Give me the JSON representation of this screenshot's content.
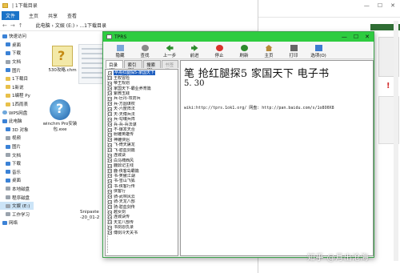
{
  "explorer": {
    "title": "| 1下载目录",
    "ribbon_tabs": [
      "文件",
      "主页",
      "共享",
      "查看"
    ],
    "address": "此电脑 › 文娱 (E:) › ...1下载目录",
    "sidebar": [
      {
        "label": "快速访问",
        "icon": "star-icon",
        "level": 0,
        "color": "g-blue"
      },
      {
        "label": "桌面",
        "icon": "desktop-icon",
        "level": 1,
        "color": "g-blue"
      },
      {
        "label": "下载",
        "icon": "download-icon",
        "level": 1,
        "color": "g-blue"
      },
      {
        "label": "文档",
        "icon": "document-icon",
        "level": 1,
        "color": "g-gray"
      },
      {
        "label": "图片",
        "icon": "picture-icon",
        "level": 1,
        "color": "g-blue"
      },
      {
        "label": "1下载目",
        "icon": "folder-icon",
        "level": 1,
        "color": "g-yellow"
      },
      {
        "label": "1新说",
        "icon": "folder-icon",
        "level": 1,
        "color": "g-yellow"
      },
      {
        "label": "1编程 Py",
        "icon": "folder-icon",
        "level": 1,
        "color": "g-yellow"
      },
      {
        "label": "1西雨表",
        "icon": "folder-icon",
        "level": 1,
        "color": "g-yellow"
      },
      {
        "label": "WPS网盘",
        "icon": "cloud-icon",
        "level": 0,
        "color": "g-cloud"
      },
      {
        "label": "此电脑",
        "icon": "computer-icon",
        "level": 0,
        "color": "g-blue"
      },
      {
        "label": "3D 对象",
        "icon": "cube-icon",
        "level": 1,
        "color": "g-blue"
      },
      {
        "label": "视频",
        "icon": "video-icon",
        "level": 1,
        "color": "g-gray"
      },
      {
        "label": "图片",
        "icon": "picture-icon",
        "level": 1,
        "color": "g-blue"
      },
      {
        "label": "文档",
        "icon": "document-icon",
        "level": 1,
        "color": "g-gray"
      },
      {
        "label": "下载",
        "icon": "download-icon",
        "level": 1,
        "color": "g-blue"
      },
      {
        "label": "音乐",
        "icon": "music-icon",
        "level": 1,
        "color": "g-blue"
      },
      {
        "label": "桌面",
        "icon": "desktop-icon",
        "level": 1,
        "color": "g-blue"
      },
      {
        "label": "本地磁盘",
        "icon": "drive-icon",
        "level": 1,
        "color": "g-gray"
      },
      {
        "label": "程序磁盘",
        "icon": "drive-icon",
        "level": 1,
        "color": "g-gray"
      },
      {
        "label": "文娱 (E:)",
        "icon": "drive-icon",
        "level": 1,
        "color": "g-gray",
        "selected": true
      },
      {
        "label": "工作学习",
        "icon": "drive-icon",
        "level": 1,
        "color": "g-gray"
      },
      {
        "label": "网络",
        "icon": "network-icon",
        "level": 0,
        "color": "g-blue"
      }
    ],
    "files": [
      {
        "label": "530攻略.chm",
        "kind": "chm"
      },
      {
        "label": "winchm Pro安装包.exe",
        "kind": "exe"
      }
    ],
    "snip_label": "Snipaste\n-20_01-2"
  },
  "chm": {
    "title": "TPRS",
    "toolbar": [
      {
        "label": "隐藏",
        "icon": "ti-hide",
        "name": "hide"
      },
      {
        "label": "查找",
        "icon": "ti-find",
        "name": "find"
      },
      {
        "label": "上一步",
        "icon": "ti-back",
        "name": "back"
      },
      {
        "label": "前进",
        "icon": "ti-fwd",
        "name": "forward"
      },
      {
        "label": "停止",
        "icon": "ti-stop",
        "name": "stop"
      },
      {
        "label": "刷新",
        "icon": "ti-refresh",
        "name": "refresh"
      },
      {
        "label": "主页",
        "icon": "ti-home",
        "name": "home"
      },
      {
        "label": "打印",
        "icon": "ti-print",
        "name": "print"
      },
      {
        "label": "选项(O)",
        "icon": "ti-opt",
        "name": "options"
      }
    ],
    "nav_tabs": [
      {
        "label": "目录(C)",
        "active": true
      },
      {
        "label": "索引(N)",
        "active": false
      },
      {
        "label": "搜索(S)",
        "active": false
      },
      {
        "label": "书签(I)",
        "active": false,
        "dim": true
      }
    ],
    "toc": [
      "卒舟红腿探5-家国天下",
      "王权冒险",
      "帝王规划",
      "家国天下-霸业养育篇",
      "紫微玉践",
      "兵-巨丹-攻防兵",
      "兵-方圆谋权",
      "天-六度阵法",
      "天-天傅兵法",
      "兵-勾魂兵阵",
      "兵-兵-兵法谋",
      "不-爆发天合",
      "射雕英雄传",
      "神雕侠侣",
      "飞-倚天屠龙",
      "飞-碧血剑篇",
      "连城诀",
      "白马啸西风",
      "鹿鼎记主线",
      "鹿-侠客岛霸篇",
      "书-笑傲江湖",
      "书-雪山飞狐",
      "书-侠客行传",
      "侠客行",
      "骑-武林风云",
      "骑-天龙八部",
      "骑-碧血剑传",
      "越女剑",
      "连城诀传",
      "天龙八部传",
      "书剑恩仇录",
      "傅剑冷天关书"
    ],
    "content": {
      "heading": "笔 抢红腿探5 家国天下 电子书",
      "sub": "5. 30",
      "line": "wiki:http://tprs.1ok1.org/ 网盘: http://pan.baidu.com/s/1o8O0X8"
    }
  },
  "watermark": "知乎 @月出沧海"
}
